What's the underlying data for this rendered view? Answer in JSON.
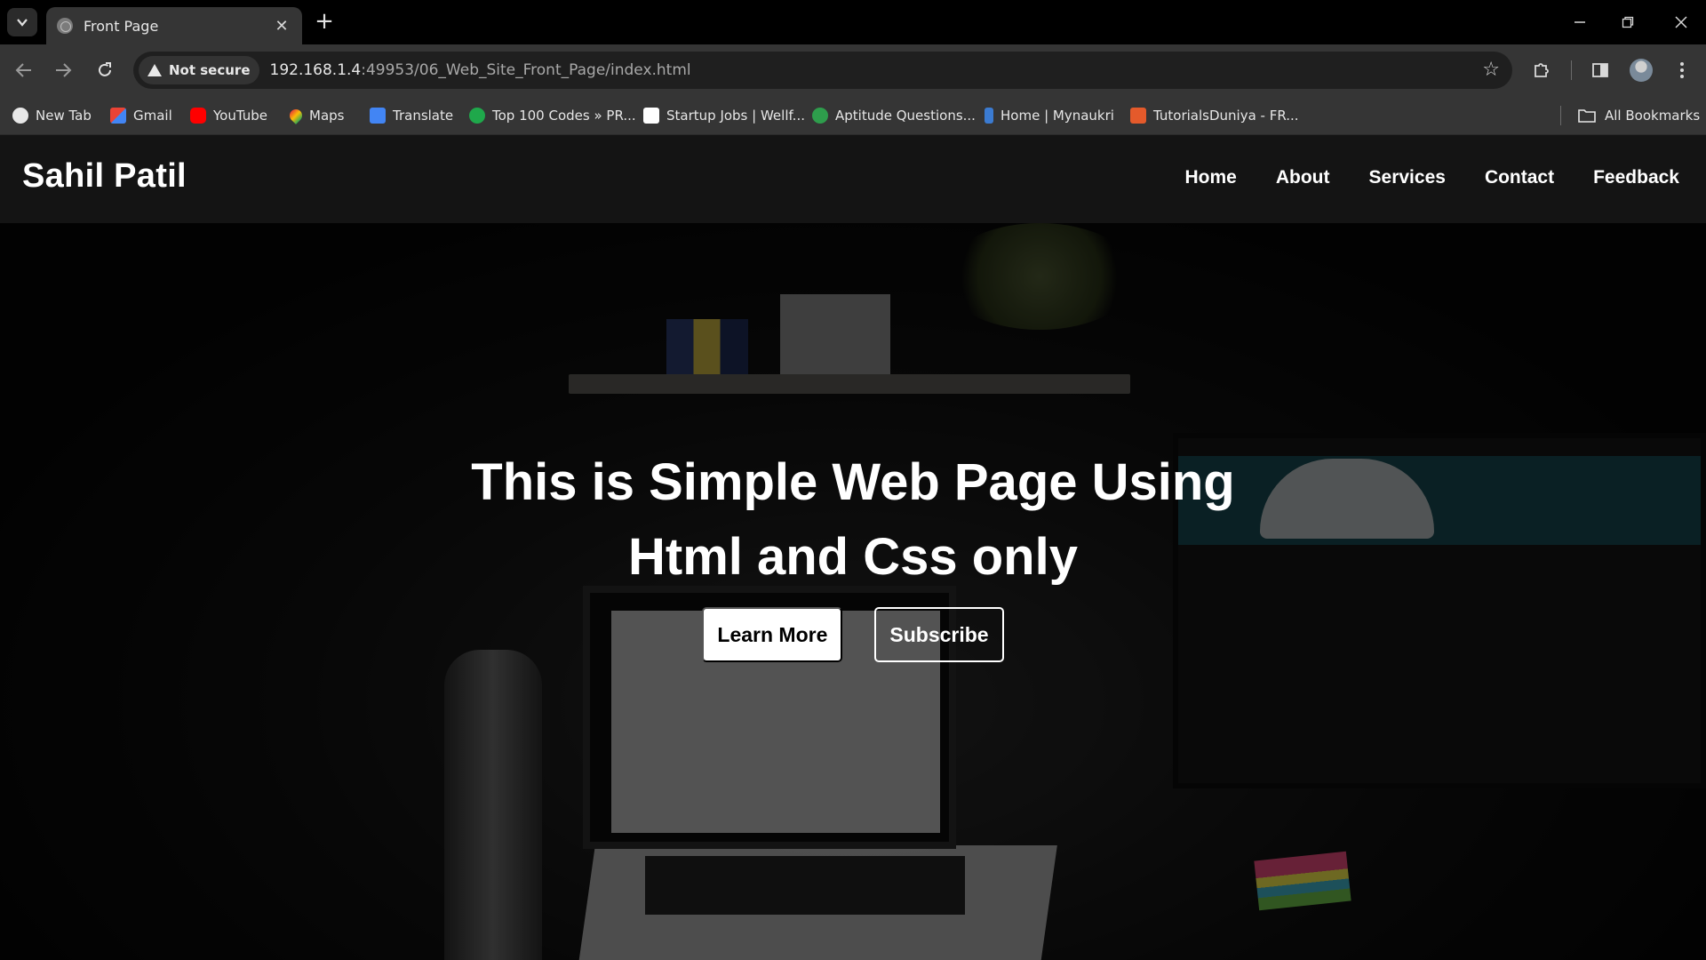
{
  "browser": {
    "tab_title": "Front Page",
    "url_host": "192.168.1.4",
    "url_rest": ":49953/06_Web_Site_Front_Page/index.html",
    "security_label": "Not secure",
    "bookmarks": [
      {
        "label": "New Tab",
        "icon": "globe-icon",
        "color": "#e8e8e8"
      },
      {
        "label": "Gmail",
        "icon": "gmail-icon",
        "color": "#ea4335"
      },
      {
        "label": "YouTube",
        "icon": "youtube-icon",
        "color": "#ff0000"
      },
      {
        "label": "Maps",
        "icon": "maps-icon",
        "color": "#34a853"
      },
      {
        "label": "Translate",
        "icon": "translate-icon",
        "color": "#4285f4"
      },
      {
        "label": "Top 100 Codes » PR...",
        "icon": "codes-icon",
        "color": "#1fa84b"
      },
      {
        "label": "Startup Jobs | Wellf...",
        "icon": "startup-jobs-icon",
        "color": "#ffffff"
      },
      {
        "label": "Aptitude Questions...",
        "icon": "aptitude-icon",
        "color": "#2e9d4c"
      },
      {
        "label": "Home | Mynaukri",
        "icon": "mynaukri-icon",
        "color": "#3b7bd1"
      },
      {
        "label": "TutorialsDuniya - FR...",
        "icon": "tutorialsduniya-icon",
        "color": "#e45a2b"
      }
    ],
    "all_bookmarks_label": "All Bookmarks"
  },
  "site": {
    "logo": "Sahil Patil",
    "nav": [
      "Home",
      "About",
      "Services",
      "Contact",
      "Feedback"
    ],
    "hero": {
      "title": "This is Simple Web Page Using Html and Css only",
      "primary_button": "Learn More",
      "secondary_button": "Subscribe"
    }
  }
}
